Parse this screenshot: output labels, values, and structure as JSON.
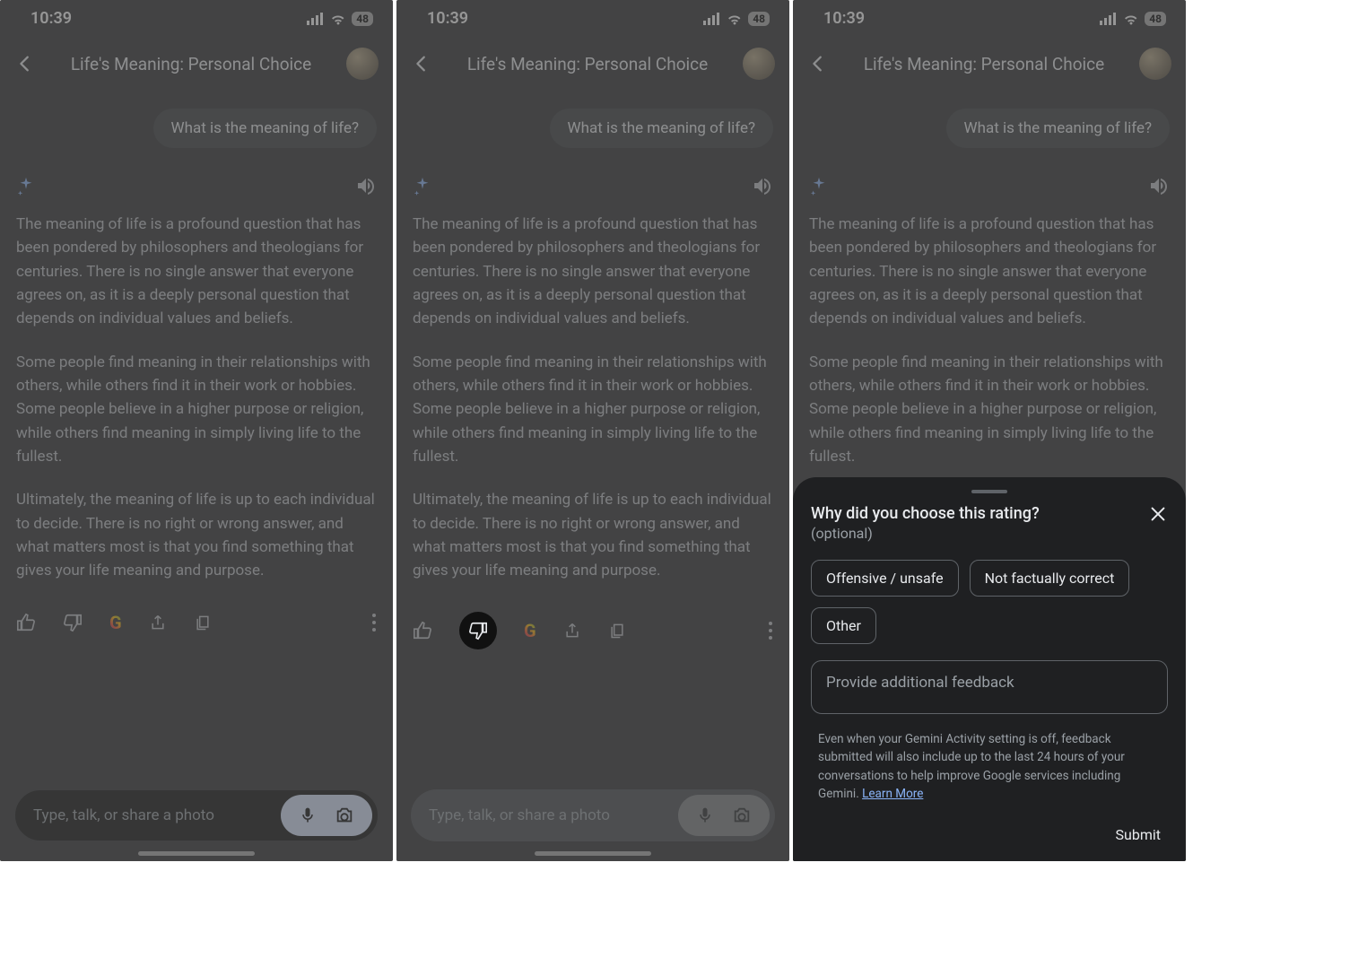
{
  "status": {
    "time": "10:39",
    "battery": "48"
  },
  "header": {
    "title": "Life's Meaning: Personal Choice"
  },
  "conversation": {
    "user_message": "What is the meaning of life?",
    "ai_paragraph_1": "The meaning of life is a profound question that has been pondered by philosophers and theologians for centuries. There is no single answer that everyone agrees on, as it is a deeply personal question that depends on individual values and beliefs.",
    "ai_paragraph_2": "Some people find meaning in their relationships with others, while others find it in their work or hobbies. Some people believe in a higher purpose or religion, while others find meaning in simply living life to the fullest.",
    "ai_paragraph_3": "Ultimately, the meaning of life is up to each individual to decide. There is no right or wrong answer, and what matters most is that you find something that gives your life meaning and purpose."
  },
  "input": {
    "placeholder": "Type, talk, or share a photo"
  },
  "feedback": {
    "title": "Why did you choose this rating?",
    "optional": "(optional)",
    "chips": {
      "offensive": "Offensive / unsafe",
      "not_factual": "Not factually correct",
      "other": "Other"
    },
    "field_placeholder": "Provide additional feedback",
    "disclaimer_text": "Even when your Gemini Activity setting is off, feedback submitted will also include up to the last 24 hours of your conversations to help improve Google services including Gemini. ",
    "learn_more": "Learn More",
    "submit": "Submit"
  }
}
